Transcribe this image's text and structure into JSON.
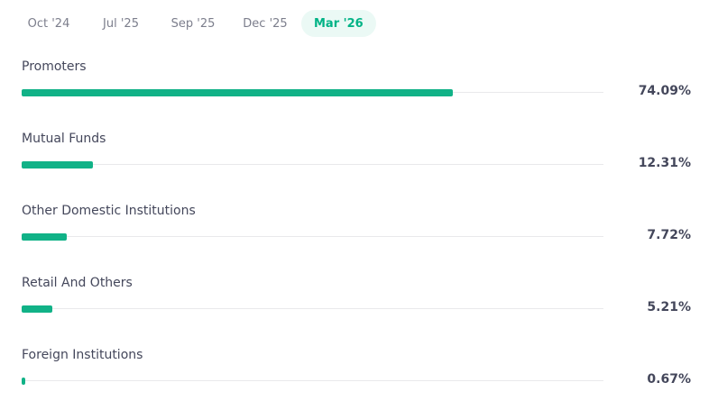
{
  "tabs": [
    {
      "label": "Oct '24",
      "active": false
    },
    {
      "label": "Jul '25",
      "active": false
    },
    {
      "label": "Sep '25",
      "active": false
    },
    {
      "label": "Dec '25",
      "active": false
    },
    {
      "label": "Mar '26",
      "active": true
    }
  ],
  "holdings": [
    {
      "label": "Promoters",
      "value": 74.09,
      "display": "74.09%"
    },
    {
      "label": "Mutual Funds",
      "value": 12.31,
      "display": "12.31%"
    },
    {
      "label": "Other Domestic Institutions",
      "value": 7.72,
      "display": "7.72%"
    },
    {
      "label": "Retail And Others",
      "value": 5.21,
      "display": "5.21%"
    },
    {
      "label": "Foreign Institutions",
      "value": 0.67,
      "display": "0.67%"
    }
  ],
  "colors": {
    "accent": "#00b386",
    "bar_fill": "#11b287",
    "active_tab_bg": "#ebf9f5",
    "track": "#e9e9eb",
    "text": "#44475b",
    "muted": "#7c7e8c"
  }
}
